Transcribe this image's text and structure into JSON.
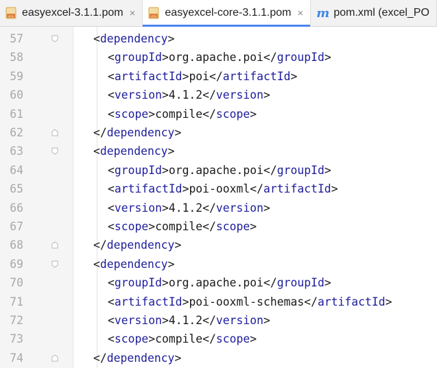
{
  "tabs": [
    {
      "label": "easyexcel-3.1.1.pom",
      "icon": "pom-file-icon",
      "active": false,
      "closable": true
    },
    {
      "label": "easyexcel-core-3.1.1.pom",
      "icon": "pom-file-icon",
      "active": true,
      "closable": true
    },
    {
      "label": "pom.xml (excel_PO",
      "icon": "maven-m-icon",
      "active": false,
      "closable": false
    }
  ],
  "close_glyph": "×",
  "maven_glyph": "m",
  "colors": {
    "tag": "#1d1d9c",
    "line_number": "#a8a8a8",
    "active_tab_underline": "#4a83f0",
    "maven_icon": "#3d87e6"
  },
  "lines": [
    {
      "n": "57",
      "fold": "open",
      "indent": 0,
      "tag": "dependency",
      "kind": "open"
    },
    {
      "n": "58",
      "fold": "",
      "indent": 1,
      "tag": "groupId",
      "value": "org.apache.poi",
      "kind": "element"
    },
    {
      "n": "59",
      "fold": "",
      "indent": 1,
      "tag": "artifactId",
      "value": "poi",
      "kind": "element"
    },
    {
      "n": "60",
      "fold": "",
      "indent": 1,
      "tag": "version",
      "value": "4.1.2",
      "kind": "element"
    },
    {
      "n": "61",
      "fold": "",
      "indent": 1,
      "tag": "scope",
      "value": "compile",
      "kind": "element"
    },
    {
      "n": "62",
      "fold": "close",
      "indent": 0,
      "tag": "dependency",
      "kind": "close"
    },
    {
      "n": "63",
      "fold": "open",
      "indent": 0,
      "tag": "dependency",
      "kind": "open"
    },
    {
      "n": "64",
      "fold": "",
      "indent": 1,
      "tag": "groupId",
      "value": "org.apache.poi",
      "kind": "element"
    },
    {
      "n": "65",
      "fold": "",
      "indent": 1,
      "tag": "artifactId",
      "value": "poi-ooxml",
      "kind": "element"
    },
    {
      "n": "66",
      "fold": "",
      "indent": 1,
      "tag": "version",
      "value": "4.1.2",
      "kind": "element"
    },
    {
      "n": "67",
      "fold": "",
      "indent": 1,
      "tag": "scope",
      "value": "compile",
      "kind": "element"
    },
    {
      "n": "68",
      "fold": "close",
      "indent": 0,
      "tag": "dependency",
      "kind": "close"
    },
    {
      "n": "69",
      "fold": "open",
      "indent": 0,
      "tag": "dependency",
      "kind": "open"
    },
    {
      "n": "70",
      "fold": "",
      "indent": 1,
      "tag": "groupId",
      "value": "org.apache.poi",
      "kind": "element"
    },
    {
      "n": "71",
      "fold": "",
      "indent": 1,
      "tag": "artifactId",
      "value": "poi-ooxml-schemas",
      "kind": "element"
    },
    {
      "n": "72",
      "fold": "",
      "indent": 1,
      "tag": "version",
      "value": "4.1.2",
      "kind": "element"
    },
    {
      "n": "73",
      "fold": "",
      "indent": 1,
      "tag": "scope",
      "value": "compile",
      "kind": "element"
    },
    {
      "n": "74",
      "fold": "close",
      "indent": 0,
      "tag": "dependency",
      "kind": "close"
    }
  ]
}
